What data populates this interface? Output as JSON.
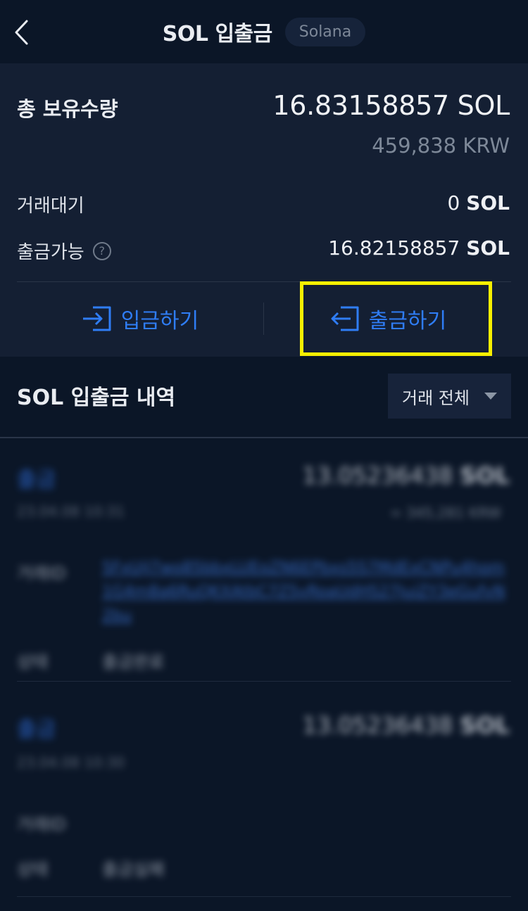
{
  "header": {
    "title": "SOL 입출금",
    "network": "Solana"
  },
  "summary": {
    "total_label": "총 보유수량",
    "total_amount": "16.83158857 SOL",
    "total_krw": "459,838 KRW",
    "pending_label": "거래대기",
    "pending_value": "0",
    "pending_unit": "SOL",
    "withdrawable_label": "출금가능",
    "withdrawable_value": "16.82158857",
    "withdrawable_unit": "SOL"
  },
  "actions": {
    "deposit_label": "입금하기",
    "withdraw_label": "출금하기"
  },
  "history": {
    "title": "SOL 입출금 내역",
    "filter_label": "거래 전체",
    "transactions": [
      {
        "type": "출금",
        "date": "23.04.08 10:31",
        "amount": "13.05236438",
        "unit": "SOL",
        "krw": "≈ 345,281 KRW",
        "txid_label": "거래ID",
        "txid": "5FxUiJ7wo85bbxLUEoZN6EPbxs5S7MdExCNPu4hom1G4m8a6RuQKXAtbC7Z5vRoaUdHS27JuiZY3eGufvN2bu",
        "status_label": "상태",
        "status": "출금완료"
      },
      {
        "type": "출금",
        "date": "23.04.08 10:30",
        "amount": "13.05236438",
        "unit": "SOL",
        "txid_label": "거래ID",
        "status_label": "상태",
        "status": "출금실패"
      }
    ]
  }
}
